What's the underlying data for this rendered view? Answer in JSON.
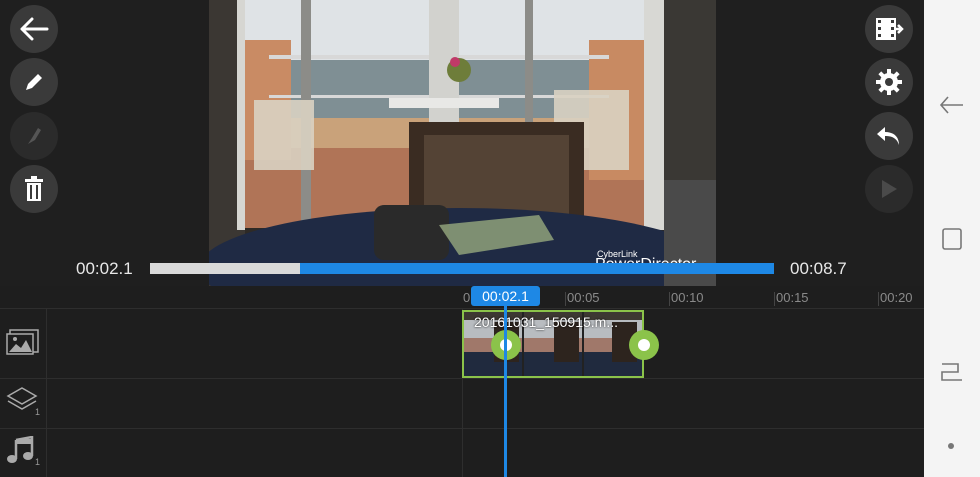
{
  "preview": {
    "current_time": "00:02.1",
    "end_time": "00:08.7",
    "progress": 0.24,
    "watermark_small": "CyberLink",
    "watermark": "PowerDirector"
  },
  "left_tools": [
    {
      "name": "back-arrow-icon"
    },
    {
      "name": "pencil-icon"
    },
    {
      "name": "brush-icon"
    },
    {
      "name": "trash-icon"
    }
  ],
  "right_tools": [
    {
      "name": "export-film-icon"
    },
    {
      "name": "gear-icon"
    },
    {
      "name": "undo-icon"
    },
    {
      "name": "play-icon"
    }
  ],
  "timeline": {
    "playhead": "00:02.1",
    "ruler": [
      "0",
      "00:05",
      "00:10",
      "00:15",
      "00:20"
    ],
    "clip_name": "20161031_150915.m...",
    "tracks": [
      {
        "name": "video-track-icon",
        "count": ""
      },
      {
        "name": "overlay-layers-icon",
        "count": "1"
      },
      {
        "name": "music-track-icon",
        "count": "1"
      }
    ]
  },
  "colors": {
    "accent": "#1e88e5",
    "clip_border": "#8bc34a",
    "background": "#1f1f1f"
  }
}
